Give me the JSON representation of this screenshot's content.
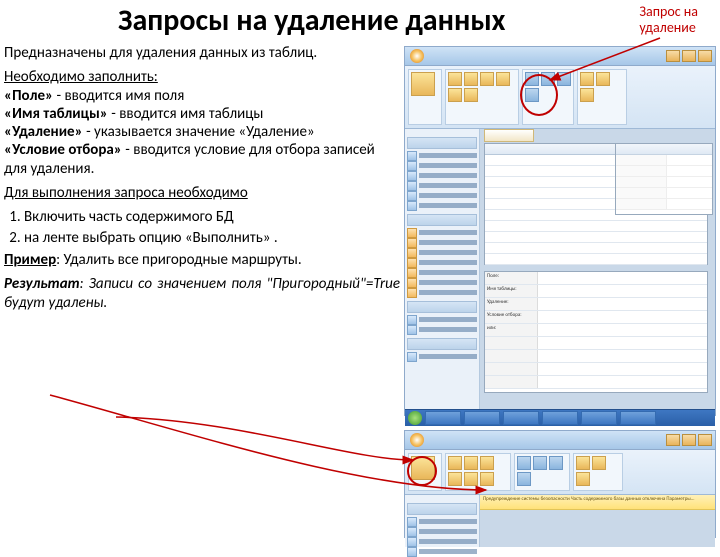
{
  "title": "Запросы на удаление данных",
  "top_right_label": "Запрос на\nудаление",
  "intro": "Предназначены для удаления данных из таблиц.",
  "must_fill_heading": "Необходимо заполнить:",
  "fields_text": "«Поле» - вводится имя поля\n«Имя таблицы» - вводится имя таблицы\n«Удаление» - указывается значение «Удаление»\n«Условие отбора» - вводится условие для отбора записей для удаления.",
  "exec_heading": "Для выполнения запроса необходимо",
  "steps": [
    "Включить часть содержимого БД",
    "на ленте выбрать опцию «Выполнить» ."
  ],
  "example_label": "Пример",
  "example_text": ": Удалить все пригородные маршруты.",
  "result_label": "Результат",
  "result_text": ": Записи со значением поля \"Пригородный\"=True будут удалены.",
  "designer_rows": [
    "Поле:",
    "Имя таблицы:",
    "Удаление:",
    "Условие отбора:",
    "или:"
  ],
  "security_bar": "Предупреждение системы безопасности   Часть содержимого базы данных отключена   Параметры..."
}
